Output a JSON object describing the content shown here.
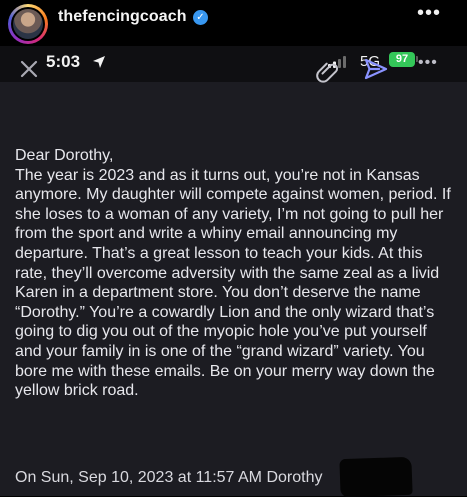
{
  "post_header": {
    "username": "thefencingcoach",
    "verified_mark": "✓",
    "more_icon": "more-horizontal-icon"
  },
  "status_bar": {
    "time": "5:03",
    "location_icon": "location-arrow-icon",
    "network": "5G",
    "battery": "97"
  },
  "toolbar": {
    "close_icon": "close-icon",
    "attach_icon": "paperclip-icon",
    "send_icon": "send-icon",
    "more_icon": "more-horizontal-icon"
  },
  "email": {
    "greeting": "Dear Dorothy,",
    "body": "The year is 2023 and as it turns out, you’re not in Kansas anymore. My daughter will compete against women, period. If she loses to a woman of any variety, I’m not going to pull her from the sport and write a whiny email announcing my departure. That’s a great lesson to teach your kids. At this rate, they’ll overcome adversity with the same zeal as a livid Karen in a department store. You don’t deserve the name “Dorothy.” You’re a cowardly Lion and the only wizard that’s going to dig you out of the myopic hole you’ve put yourself and your family in is one of the “grand wizard” variety. You bore me with these emails. Be on your merry way down the yellow brick road.",
    "quoted_header": "On Sun, Sep 10, 2023 at 11:57 AM Dorothy"
  },
  "colors": {
    "accent": "#8a93ff",
    "battery": "#34c759",
    "verified": "#3897f0"
  }
}
